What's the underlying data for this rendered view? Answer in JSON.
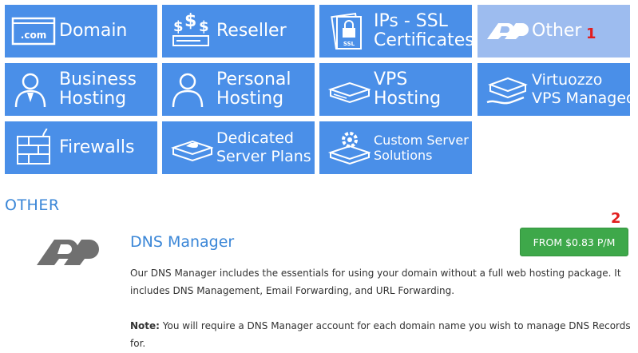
{
  "tiles": [
    {
      "label": "Domain",
      "icon": "domain-com-icon"
    },
    {
      "label": "Reseller",
      "icon": "reseller-server-icon"
    },
    {
      "label": "IPs - SSL Certificates",
      "line1": "IPs - SSL",
      "line2": "Certificates",
      "icon": "ssl-certificate-icon"
    },
    {
      "label": "Other",
      "icon": "other-logo-icon",
      "active": true
    },
    {
      "label": "Business Hosting",
      "line1": "Business",
      "line2": "Hosting",
      "icon": "business-person-icon"
    },
    {
      "label": "Personal Hosting",
      "line1": "Personal",
      "line2": "Hosting",
      "icon": "personal-person-icon"
    },
    {
      "label": "VPS Hosting",
      "line1": "VPS",
      "line2": "Hosting",
      "icon": "vps-server-icon"
    },
    {
      "label": "Virtuozzo VPS Managed",
      "line1": "Virtuozzo",
      "line2": "VPS Managed",
      "icon": "managed-server-icon"
    },
    {
      "label": "Firewalls",
      "icon": "firewall-icon"
    },
    {
      "label": "Dedicated Server Plans",
      "line1": "Dedicated",
      "line2": "Server Plans",
      "icon": "dedicated-server-icon"
    },
    {
      "label": "Custom Server Solutions",
      "line1": "Custom Server",
      "line2": "Solutions",
      "icon": "custom-server-gear-icon"
    }
  ],
  "annotations": {
    "marker1": "1",
    "marker2": "2"
  },
  "section": {
    "title": "OTHER"
  },
  "product": {
    "name": "DNS Manager",
    "price_button": "FROM $0.83 P/M",
    "description": "Our DNS Manager includes the essentials for using your domain without a full web hosting package. It includes DNS Management, Email Forwarding, and URL Forwarding.",
    "note_label": "Note:",
    "note_text": " You will require a DNS Manager account for each domain name you wish to manage DNS Records for."
  },
  "colors": {
    "tile": "#4a8fe8",
    "tile_active": "#9dbcef",
    "accent_text": "#3a86d7",
    "price_button": "#3ea84a",
    "marker": "#e21d1d"
  }
}
